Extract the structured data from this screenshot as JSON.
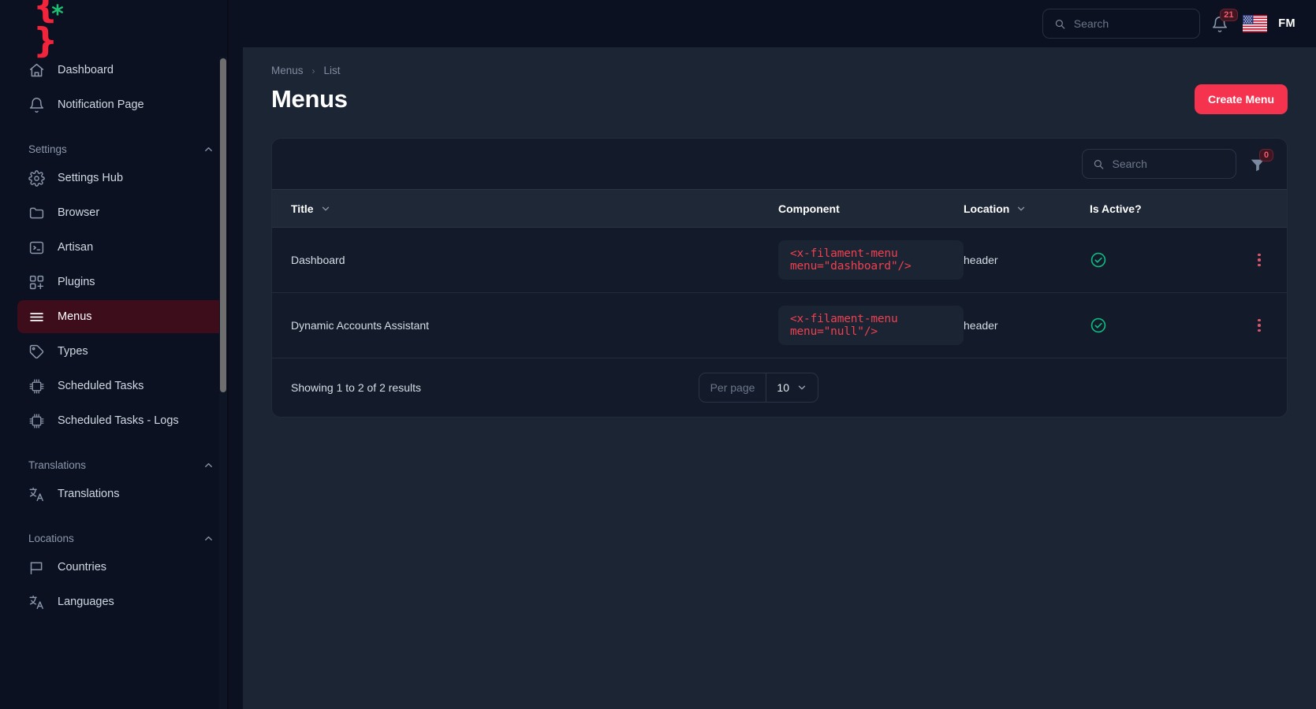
{
  "brand": {
    "logo_braces": "{ }",
    "logo_star": "*",
    "accent": "#f5334f",
    "success": "#10b981"
  },
  "topbar": {
    "search": {
      "placeholder": "Search",
      "value": ""
    },
    "notifications": {
      "icon": "bell-icon",
      "count": "21"
    },
    "locale": {
      "icon": "us-flag-icon",
      "label": "United States"
    },
    "user": {
      "initials": "FM"
    }
  },
  "sidebar": {
    "items": [
      {
        "label": "Dashboard",
        "icon": "home-icon",
        "active": false
      },
      {
        "label": "Notification Page",
        "icon": "bell-icon",
        "active": false
      }
    ],
    "groups": [
      {
        "label": "Settings",
        "chevron": "chevron-up-icon",
        "items": [
          {
            "label": "Settings Hub",
            "icon": "gear-icon",
            "active": false
          },
          {
            "label": "Browser",
            "icon": "folder-icon",
            "active": false
          },
          {
            "label": "Artisan",
            "icon": "terminal-icon",
            "active": false
          },
          {
            "label": "Plugins",
            "icon": "plugins-icon",
            "active": false
          },
          {
            "label": "Menus",
            "icon": "menu-lines-icon",
            "active": true
          },
          {
            "label": "Types",
            "icon": "tag-icon",
            "active": false
          },
          {
            "label": "Scheduled Tasks",
            "icon": "chip-icon",
            "active": false
          },
          {
            "label": "Scheduled Tasks - Logs",
            "icon": "chip-icon",
            "active": false
          }
        ]
      },
      {
        "label": "Translations",
        "chevron": "chevron-up-icon",
        "items": [
          {
            "label": "Translations",
            "icon": "language-icon",
            "active": false
          }
        ]
      },
      {
        "label": "Locations",
        "chevron": "chevron-up-icon",
        "items": [
          {
            "label": "Countries",
            "icon": "flag-icon",
            "active": false
          },
          {
            "label": "Languages",
            "icon": "language-icon",
            "active": false
          }
        ]
      }
    ]
  },
  "page": {
    "breadcrumb": {
      "root": "Menus",
      "current": "List",
      "separator": "›"
    },
    "title": "Menus",
    "create_button": "Create Menu"
  },
  "table": {
    "search": {
      "placeholder": "Search",
      "value": ""
    },
    "filter": {
      "icon": "funnel-icon",
      "count": "0"
    },
    "columns": [
      {
        "label": "Title",
        "sortable": true
      },
      {
        "label": "Component",
        "sortable": false
      },
      {
        "label": "Location",
        "sortable": true
      },
      {
        "label": "Is Active?",
        "sortable": false
      }
    ],
    "rows": [
      {
        "title": "Dashboard",
        "component": "<x-filament-menu menu=\"dashboard\"/>",
        "location": "header",
        "is_active": true,
        "actions_icon": "vertical-dots-icon"
      },
      {
        "title": "Dynamic Accounts Assistant",
        "component": "<x-filament-menu menu=\"null\"/>",
        "location": "header",
        "is_active": true,
        "actions_icon": "vertical-dots-icon"
      }
    ],
    "footer": {
      "showing": "Showing 1 to 2 of 2 results",
      "per_page_label": "Per page",
      "per_page_value": "10"
    }
  }
}
